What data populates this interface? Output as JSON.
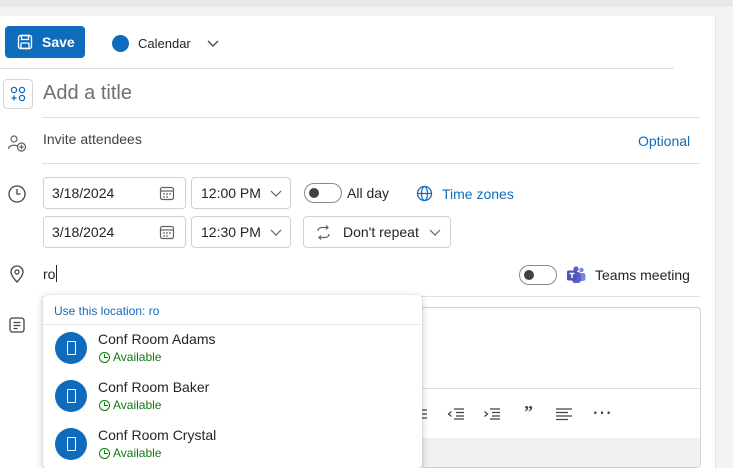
{
  "toolbar": {
    "save_label": "Save",
    "calendar_label": "Calendar",
    "calendar_color": "#0f6cbd"
  },
  "title": {
    "placeholder": "Add a title"
  },
  "attendees": {
    "placeholder": "Invite attendees",
    "optional_label": "Optional"
  },
  "schedule": {
    "start_date": "3/18/2024",
    "start_time": "12:00 PM",
    "end_date": "3/18/2024",
    "end_time": "12:30 PM",
    "all_day_label": "All day",
    "all_day_on": false,
    "time_zones_label": "Time zones",
    "repeat_label": "Don't repeat"
  },
  "location": {
    "value": "ro",
    "teams_label": "Teams meeting",
    "teams_on": false
  },
  "suggestions": {
    "header": "Use this location: ro",
    "items": [
      {
        "name": "Conf Room Adams",
        "status": "Available"
      },
      {
        "name": "Conf Room Baker",
        "status": "Available"
      },
      {
        "name": "Conf Room Crystal",
        "status": "Available"
      }
    ]
  },
  "editor_toolbar": {
    "quote_glyph": "”",
    "more_glyph": "⋯"
  },
  "colors": {
    "accent": "#0f6cbd",
    "available": "#107c10",
    "teams_purple": "#5b5fc7"
  }
}
